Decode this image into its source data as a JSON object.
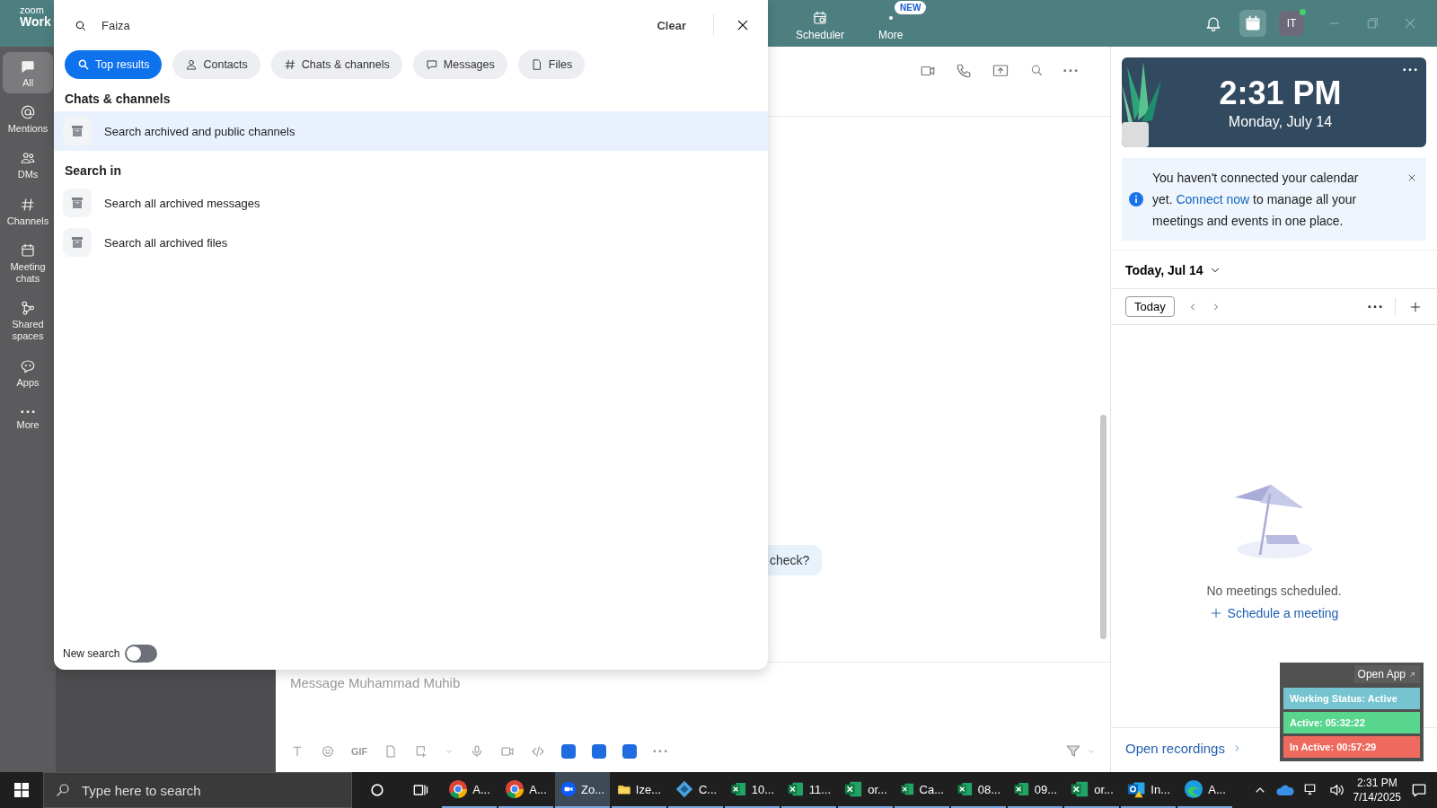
{
  "topbar": {
    "logo_top": "zoom",
    "logo_bottom": "Work",
    "nav": [
      {
        "label": "Scheduler"
      },
      {
        "label": "More",
        "badge": "NEW"
      }
    ],
    "avatar": "IT",
    "online": true
  },
  "sidebar": {
    "items": [
      {
        "label": "All",
        "selected": true
      },
      {
        "label": "Mentions",
        "selected": false
      },
      {
        "label": "DMs",
        "selected": false
      },
      {
        "label": "Channels",
        "selected": false
      },
      {
        "label": "Meeting chats",
        "selected": false
      },
      {
        "label": "Shared spaces",
        "selected": false
      },
      {
        "label": "Apps",
        "selected": false
      },
      {
        "label": "More",
        "selected": false
      }
    ]
  },
  "search": {
    "value": "Faiza",
    "clear": "Clear",
    "filters": [
      {
        "label": "Top results",
        "selected": true
      },
      {
        "label": "Contacts",
        "selected": false
      },
      {
        "label": "Chats & channels",
        "selected": false
      },
      {
        "label": "Messages",
        "selected": false
      },
      {
        "label": "Files",
        "selected": false
      }
    ],
    "sections": [
      {
        "title": "Chats & channels",
        "items": [
          {
            "label": "Search archived and public channels",
            "selected": true
          }
        ]
      },
      {
        "title": "Search in",
        "items": [
          {
            "label": "Search all archived messages",
            "selected": false
          },
          {
            "label": "Search all archived files",
            "selected": false
          }
        ]
      }
    ],
    "new_search": {
      "label": "New search",
      "on": false
    }
  },
  "chat": {
    "bubble": "check?",
    "composer_placeholder": "Message Muhammad Muhib",
    "gif": "GIF"
  },
  "calendar": {
    "time": "2:31 PM",
    "date": "Monday, July 14",
    "notice": {
      "before": "You haven't connected your calendar yet.",
      "link": "Connect now",
      "after": "to manage all your meetings and events in one place."
    },
    "day": "Today, Jul 14",
    "today_button": "Today",
    "empty": "No meetings scheduled.",
    "schedule": "Schedule a meeting",
    "recordings": "Open recordings"
  },
  "widget": {
    "open_app": "Open App",
    "rows": [
      {
        "label": "Working Status: Active",
        "color": "#76c4cf"
      },
      {
        "label": "Active: 05:32:22",
        "color": "#58d68d"
      },
      {
        "label": "In Active: 00:57:29",
        "color": "#ee6a5e"
      }
    ]
  },
  "taskbar": {
    "search_placeholder": "Type here to search",
    "apps": [
      {
        "kind": "chrome",
        "label": "A...",
        "selected": false
      },
      {
        "kind": "chrome",
        "label": "A...",
        "selected": false
      },
      {
        "kind": "zoom",
        "label": "Zo...",
        "selected": true
      },
      {
        "kind": "folder",
        "label": "Ize...",
        "selected": false
      },
      {
        "kind": "diamond",
        "label": "C...",
        "selected": false
      },
      {
        "kind": "excel",
        "label": "10...",
        "selected": false
      },
      {
        "kind": "excel",
        "label": "11...",
        "selected": false
      },
      {
        "kind": "excel",
        "label": "or...",
        "selected": false
      },
      {
        "kind": "excel",
        "label": "Ca...",
        "selected": false
      },
      {
        "kind": "excel",
        "label": "08...",
        "selected": false
      },
      {
        "kind": "excel",
        "label": "09...",
        "selected": false
      },
      {
        "kind": "excel",
        "label": "or...",
        "selected": false
      },
      {
        "kind": "outlook",
        "label": "In...",
        "selected": false
      },
      {
        "kind": "edge",
        "label": "A...",
        "selected": false
      }
    ],
    "time": "2:31 PM",
    "date": "7/14/2025"
  }
}
